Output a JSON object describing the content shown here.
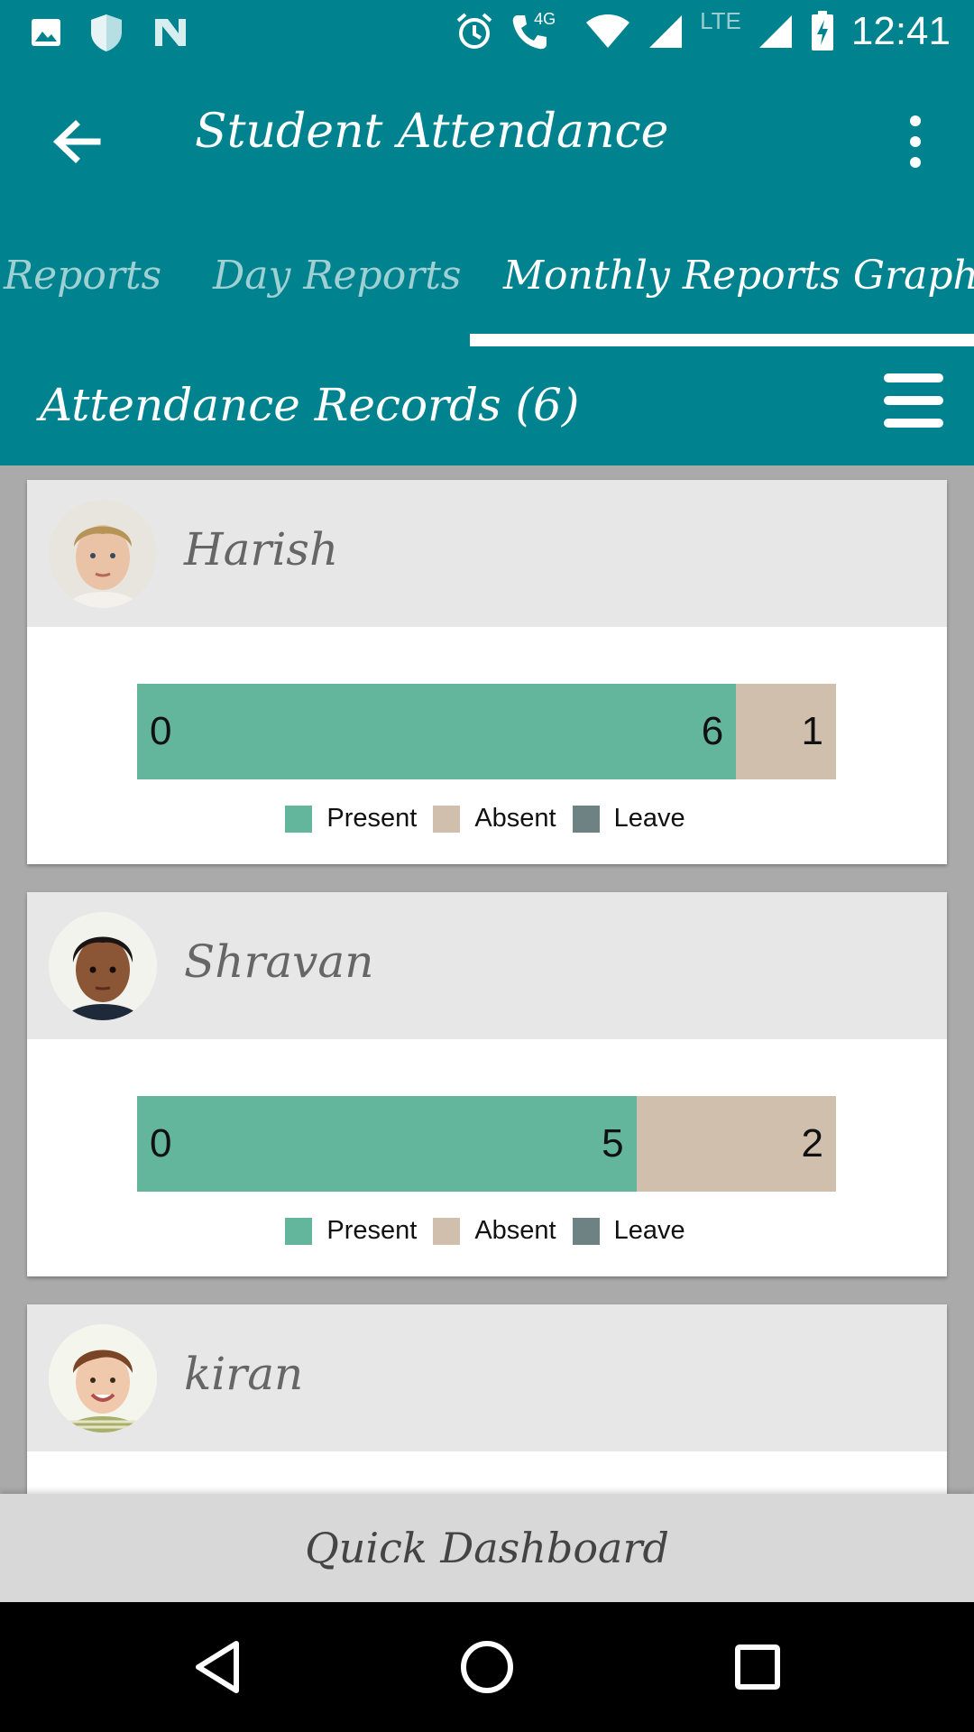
{
  "status_bar": {
    "time": "12:41",
    "network_label": "4G",
    "lte_label": "LTE",
    "icons": [
      "image-icon",
      "shield-icon",
      "n-icon",
      "alarm-icon",
      "call-icon",
      "wifi-icon",
      "signal-icon",
      "signal-icon",
      "battery-charging-icon"
    ]
  },
  "app_bar": {
    "title": "Student Attendance",
    "back_icon": "arrow-back-icon",
    "overflow_icon": "more-vert-icon"
  },
  "tabs": [
    {
      "label": "Reports",
      "active": false
    },
    {
      "label": "Day Reports",
      "active": false
    },
    {
      "label": "Monthly Reports Graphs",
      "active": true
    }
  ],
  "section": {
    "title": "Attendance Records (6)",
    "menu_icon": "hamburger-icon"
  },
  "legend": {
    "present": "Present",
    "absent": "Absent",
    "leave": "Leave"
  },
  "colors": {
    "primary": "#00838f",
    "present": "#63b59c",
    "absent": "#d0bfac",
    "leave": "#6f8283"
  },
  "students": [
    {
      "name": "Harish",
      "present": 6,
      "absent": 1,
      "leave": 0,
      "start_label": "0",
      "present_label": "6",
      "absent_label": "1"
    },
    {
      "name": "Shravan",
      "present": 5,
      "absent": 2,
      "leave": 0,
      "start_label": "0",
      "present_label": "5",
      "absent_label": "2"
    },
    {
      "name": "kiran"
    }
  ],
  "chart_data": [
    {
      "type": "bar",
      "orientation": "horizontal-stacked",
      "title": "Harish",
      "series": [
        {
          "name": "Present",
          "values": [
            6
          ]
        },
        {
          "name": "Absent",
          "values": [
            1
          ]
        },
        {
          "name": "Leave",
          "values": [
            0
          ]
        }
      ]
    },
    {
      "type": "bar",
      "orientation": "horizontal-stacked",
      "title": "Shravan",
      "series": [
        {
          "name": "Present",
          "values": [
            5
          ]
        },
        {
          "name": "Absent",
          "values": [
            2
          ]
        },
        {
          "name": "Leave",
          "values": [
            0
          ]
        }
      ]
    }
  ],
  "footer": {
    "dashboard_label": "Quick Dashboard"
  },
  "nav_bar": {
    "icons": [
      "back-triangle-icon",
      "home-circle-icon",
      "recents-square-icon"
    ]
  }
}
